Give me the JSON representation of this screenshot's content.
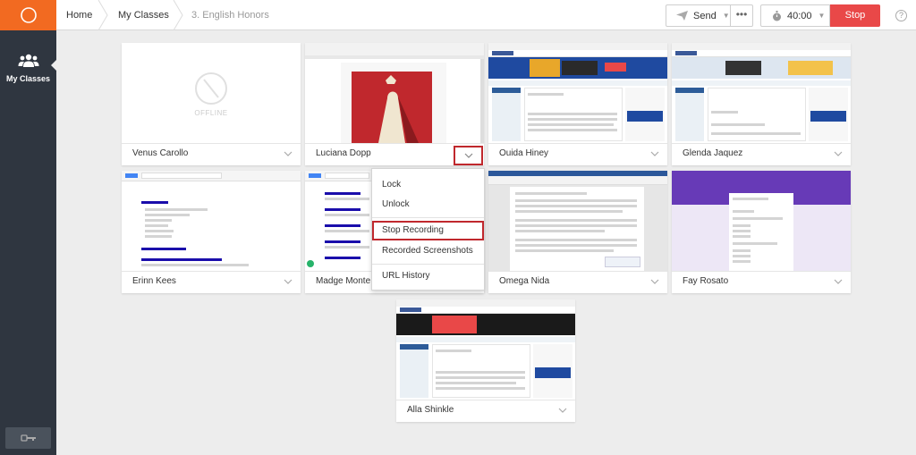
{
  "sidebar": {
    "nav_label": "My Classes"
  },
  "breadcrumb": {
    "home": "Home",
    "classes": "My Classes",
    "current": "3. English Honors"
  },
  "toolbar": {
    "send_label": "Send",
    "more_label": "•••",
    "timer_value": "40:00",
    "stop_label": "Stop",
    "help_label": "?"
  },
  "students": [
    {
      "name": "Venus Carollo",
      "status": "OFFLINE"
    },
    {
      "name": "Luciana Dopp"
    },
    {
      "name": "Ouida Hiney"
    },
    {
      "name": "Glenda Jaquez"
    },
    {
      "name": "Erinn Kees"
    },
    {
      "name": "Madge Monte"
    },
    {
      "name": "Omega Nida"
    },
    {
      "name": "Fay Rosato"
    },
    {
      "name": "Alla Shinkle"
    }
  ],
  "menu": {
    "items": [
      "Lock",
      "Unlock",
      "Stop Recording",
      "Recorded Screenshots",
      "URL History"
    ],
    "selected": "Stop Recording"
  },
  "colors": {
    "accent_orange": "#f26a21",
    "stop_red": "#e94848",
    "highlight_red": "#c0282d",
    "sidebar_dark": "#2f3640"
  }
}
